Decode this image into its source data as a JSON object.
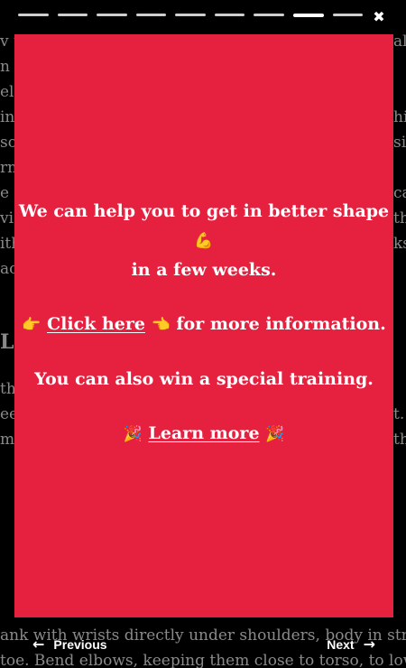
{
  "background_article": {
    "lines": [
      "v t",
      "n g",
      "ele",
      "in",
      "so",
      "rn",
      "e d",
      "vi",
      "ith",
      "ac",
      "th",
      "ee",
      "mo",
      "ank with wrists directly under shoulders, body in straight",
      "toe. Bend elbows, keeping them close to torso, to lower"
    ],
    "right_fragments": [
      "all",
      "hi",
      "si",
      "ca",
      "th",
      "ks",
      "t.",
      "th"
    ],
    "heading": "L"
  },
  "progress": {
    "segments": 9,
    "active_index": 7
  },
  "close": {
    "label": "✖"
  },
  "card": {
    "line1": "We can help you to get in better shape",
    "line1_emoji": "💪",
    "line2": "in a few weeks.",
    "click_emoji_left": "👉",
    "click_link": "Click here",
    "click_emoji_right": "👈",
    "click_rest": "for more information.",
    "win_text": "You can also win a special training.",
    "learn_emoji_left": "🎉",
    "learn_link": "Learn more",
    "learn_emoji_right": "🎉"
  },
  "nav": {
    "previous_label": "Previous",
    "previous_icon": "←",
    "next_label": "Next",
    "next_icon": "→"
  },
  "colors": {
    "card": "#e5213f",
    "overlay": "#000000",
    "text": "#ffffff"
  }
}
